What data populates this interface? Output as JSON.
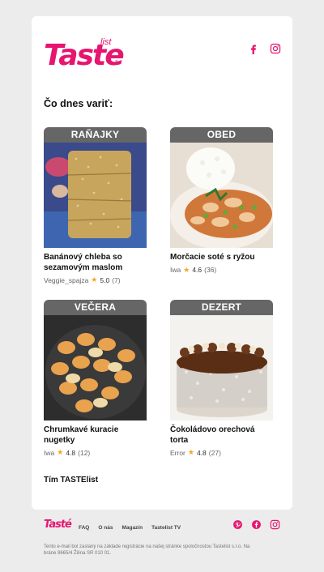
{
  "brand": {
    "logo_text": "Taste",
    "logo_sub": "list",
    "logo_reg": "®",
    "footer_logo": "Tasté"
  },
  "icons": {
    "facebook": "facebook-icon",
    "instagram": "instagram-icon",
    "pinterest": "pinterest-icon",
    "star": "star-icon"
  },
  "colors": {
    "brand": "#e6156f",
    "category_bg": "#666666",
    "star": "#f5a623"
  },
  "heading": "Čo dnes variť:",
  "recipes": [
    {
      "category": "RAŇAJKY",
      "title": "Banánový chleba so sezamovým maslom",
      "author": "Veggie_spajza",
      "rating": "5.0",
      "count": "(7)"
    },
    {
      "category": "OBED",
      "title": "Morčacie soté s ryžou",
      "author": "Iwa",
      "rating": "4.6",
      "count": "(36)"
    },
    {
      "category": "VEČERA",
      "title": "Chrumkavé kuracie nugetky",
      "author": "Iwa",
      "rating": "4.8",
      "count": "(12)"
    },
    {
      "category": "DEZERT",
      "title": "Čokoládovo orechová torta",
      "author": "Error",
      "rating": "4.8",
      "count": "(27)"
    }
  ],
  "star_glyph": "★",
  "signoff": "Tím TASTElist",
  "footer": {
    "nav": [
      "FAQ",
      "O nás",
      "Magazín",
      "Tastelist TV"
    ],
    "legal": "Tento e-mail bol zaslaný na základe registrácie na našej stránke spoločnostou Tastelist s.r.o. Na bráne 8665/4 Žilina SR 010 01."
  }
}
